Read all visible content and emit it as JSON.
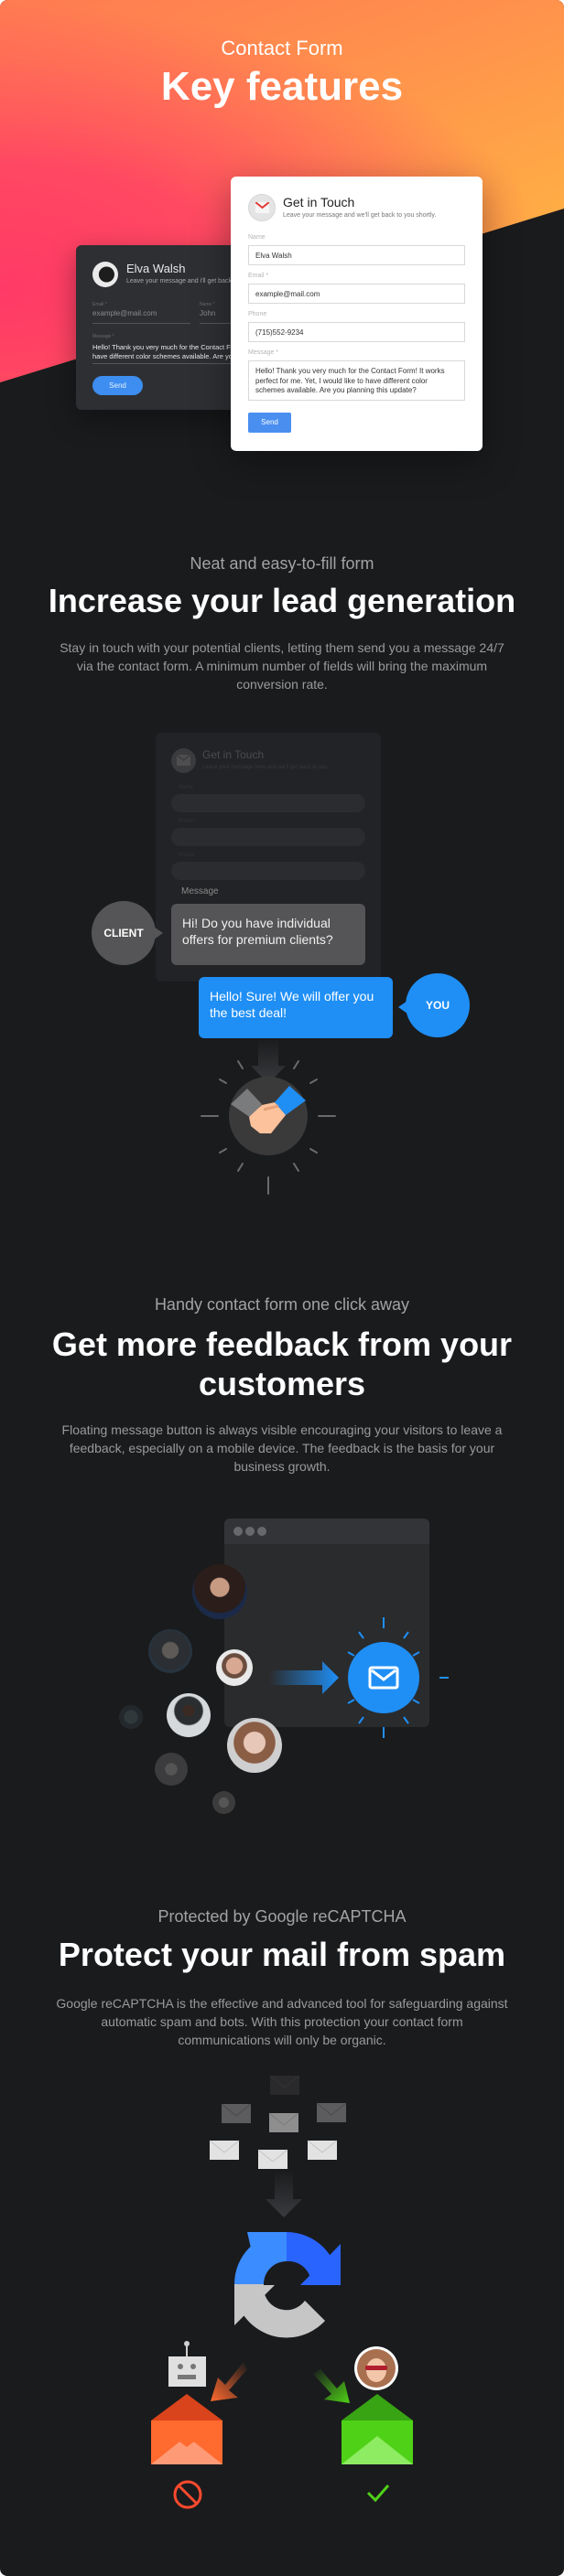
{
  "hero": {
    "subtitle": "Contact Form",
    "title": "Key features",
    "colors": {
      "gradient_start": "#ff3a66",
      "gradient_mid": "#ff8a4d",
      "gradient_end": "#ffc23f"
    },
    "dark_form": {
      "name": "Elva Walsh",
      "subtitle": "Leave your message and i'll get back to you",
      "email_label": "Email *",
      "email_placeholder": "example@mail.com",
      "name_label": "Name *",
      "name_placeholder": "John",
      "message_label": "Message *",
      "message_line1": "Hello! Thank you very much for the Contact Form! It works perfect for me. Yet, I would like to",
      "message_line2": "have different color schemes available. Are you planning this update?",
      "send_label": "Send"
    },
    "light_form": {
      "title": "Get in Touch",
      "subtitle": "Leave your message and we'll get back to you shortly.",
      "name_label": "Name",
      "name_value": "Elva Walsh",
      "email_label": "Email *",
      "email_value": "example@mail.com",
      "phone_label": "Phone",
      "phone_value": "(715)552-9234",
      "message_label": "Message *",
      "message_value": "Hello! Thank you very much for the Contact Form! It works perfect for me. Yet, I would like to have different color schemes available. Are you planning this update?",
      "send_label": "Send"
    }
  },
  "lead_section": {
    "subtitle": "Neat and easy-to-fill form",
    "title": "Increase your lead generation",
    "description": "Stay in touch with your potential clients, letting them send you a message 24/7 via the contact form. A minimum number of fields will bring the maximum conversion rate.",
    "muted_form": {
      "title": "Get in Touch",
      "subtitle": "Leave your message here and we'll get back to you",
      "name_label": "Name",
      "email_label": "Email *",
      "phone_label": "Phone",
      "message_label": "Message"
    },
    "client_label": "CLIENT",
    "client_message": "Hi! Do you have individual offers for premium clients?",
    "you_label": "YOU",
    "you_message": "Hello! Sure! We will offer you the best deal!",
    "colors": {
      "client": "#555557",
      "you": "#1f8ff5"
    }
  },
  "feedback_section": {
    "subtitle": "Handy contact form one click away",
    "title_line1": "Get more feedback from your",
    "title_line2": "customers",
    "description": "Floating message button is always visible encouraging your visitors to leave a feedback, especially on a mobile device. The feedback is the basis for your business growth.",
    "button_icon": "mail-icon",
    "accent": "#1f8ff5"
  },
  "spam_section": {
    "subtitle": "Protected by Google reCAPTCHA",
    "title": "Protect your mail from spam",
    "description": "Google reCAPTCHA is the effective and advanced tool for safeguarding against automatic spam and bots. With this protection your contact form communications will only be organic.",
    "blocked_icon": "no-entry-icon",
    "allowed_icon": "checkmark-icon",
    "colors": {
      "blocked": "#ff4a2e",
      "allowed": "#4fd117",
      "recaptcha_blue": "#3b8cff",
      "recaptcha_dark_blue": "#2a64ff",
      "recaptcha_gray": "#c6c6c6"
    }
  }
}
